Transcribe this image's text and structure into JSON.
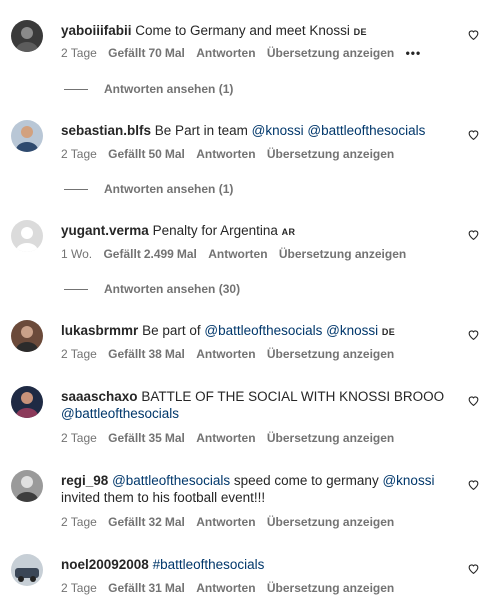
{
  "ui": {
    "likes_prefix": "Gefällt",
    "likes_suffix": "Mal",
    "reply_label": "Antworten",
    "translate_label": "Übersetzung anzeigen",
    "view_replies_prefix": "Antworten ansehen",
    "more_options": "•••",
    "colors": {
      "text": "#262626",
      "secondary": "#737373",
      "link": "#00376b"
    }
  },
  "comments": [
    {
      "username": "yaboiiifabii",
      "parts": [
        {
          "t": "Come to Germany and meet Knossi"
        }
      ],
      "flag": "DE",
      "time": "2 Tage",
      "likes": "70",
      "show_more": true,
      "replies": "1"
    },
    {
      "username": "sebastian.blfs",
      "parts": [
        {
          "t": "Be Part in team"
        },
        {
          "m": "@knossi"
        },
        {
          "m": "@battleofthesocials"
        }
      ],
      "time": "2 Tage",
      "likes": "50",
      "replies": "1"
    },
    {
      "username": "yugant.verma",
      "parts": [
        {
          "t": "Penalty for Argentina"
        }
      ],
      "flag": "AR",
      "time": "1 Wo.",
      "likes": "2.499",
      "replies": "30"
    },
    {
      "username": "lukasbrmmr",
      "parts": [
        {
          "t": "Be part of"
        },
        {
          "m": "@battleofthesocials"
        },
        {
          "m": "@knossi"
        }
      ],
      "flag": "DE",
      "time": "2 Tage",
      "likes": "38"
    },
    {
      "username": "saaaschaxo",
      "parts": [
        {
          "t": "BATTLE OF THE SOCIAL WITH KNOSSI BROOO"
        },
        {
          "m": "@battleofthesocials"
        }
      ],
      "time": "2 Tage",
      "likes": "35"
    },
    {
      "username": "regi_98",
      "parts": [
        {
          "m": "@battleofthesocials"
        },
        {
          "t": "speed come to germany"
        },
        {
          "m": "@knossi"
        },
        {
          "t": "invited them to his football event!!!"
        }
      ],
      "time": "2 Tage",
      "likes": "32"
    },
    {
      "username": "noel20092008",
      "parts": [
        {
          "m": "#battleofthesocials"
        }
      ],
      "time": "2 Tage",
      "likes": "31"
    }
  ]
}
